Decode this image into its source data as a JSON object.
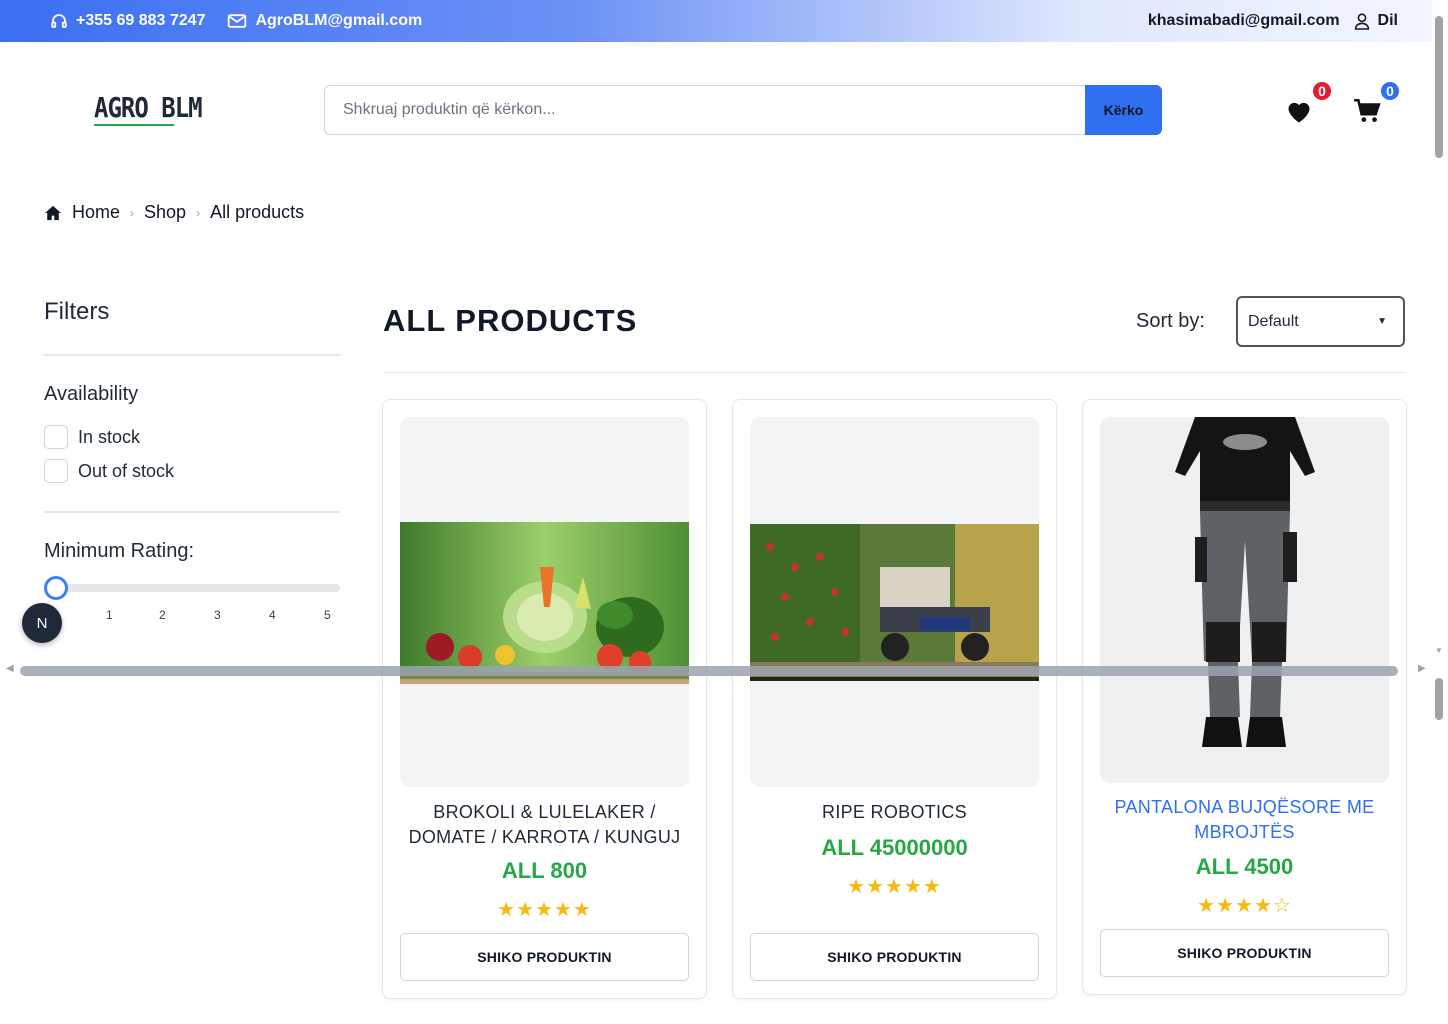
{
  "topbar": {
    "phone": "+355 69 883 7247",
    "email": "AgroBLM@gmail.com",
    "user_email": "khasimabadi@gmail.com",
    "language": "Dil"
  },
  "header": {
    "logo": "AGRO BLM",
    "search_placeholder": "Shkruaj produktin që kërkon...",
    "search_button": "Kërko",
    "wishlist_count": "0",
    "cart_count": "0"
  },
  "breadcrumb": {
    "home": "Home",
    "shop": "Shop",
    "current": "All products"
  },
  "filters": {
    "title": "Filters",
    "availability_title": "Availability",
    "in_stock": "In stock",
    "out_of_stock": "Out of stock",
    "rating_title": "Minimum Rating:",
    "rating_value": 0,
    "rating_ticks": [
      "1",
      "2",
      "3",
      "4",
      "5"
    ],
    "floating_badge": "N"
  },
  "main": {
    "title": "ALL PRODUCTS",
    "sort_label": "Sort by:",
    "sort_value": "Default"
  },
  "products": [
    {
      "name_line1": "BROKOLI & LULELAKER /",
      "name_line2": "DOMATE / KARROTA / KUNGUJ",
      "price": "ALL 800",
      "rating": 5,
      "stars": "★★★★★",
      "button": "SHIKO PRODUKTIN"
    },
    {
      "name_line1": "RIPE ROBOTICS",
      "name_line2": "",
      "price": "ALL 45000000",
      "rating": 5,
      "stars": "★★★★★",
      "button": "SHIKO PRODUKTIN"
    },
    {
      "name_line1": "PANTALONA BUJQËSORE ME",
      "name_line2": "MBROJTËS",
      "price": "ALL 4500",
      "rating": 4,
      "stars": "★★★★☆",
      "button": "SHIKO PRODUKTIN"
    }
  ],
  "colors": {
    "accent": "#2f6ff0",
    "price": "#28a745",
    "star": "#f5b90f",
    "wishlist_badge": "#e11d2e",
    "cart_badge": "#2f6ff0"
  }
}
